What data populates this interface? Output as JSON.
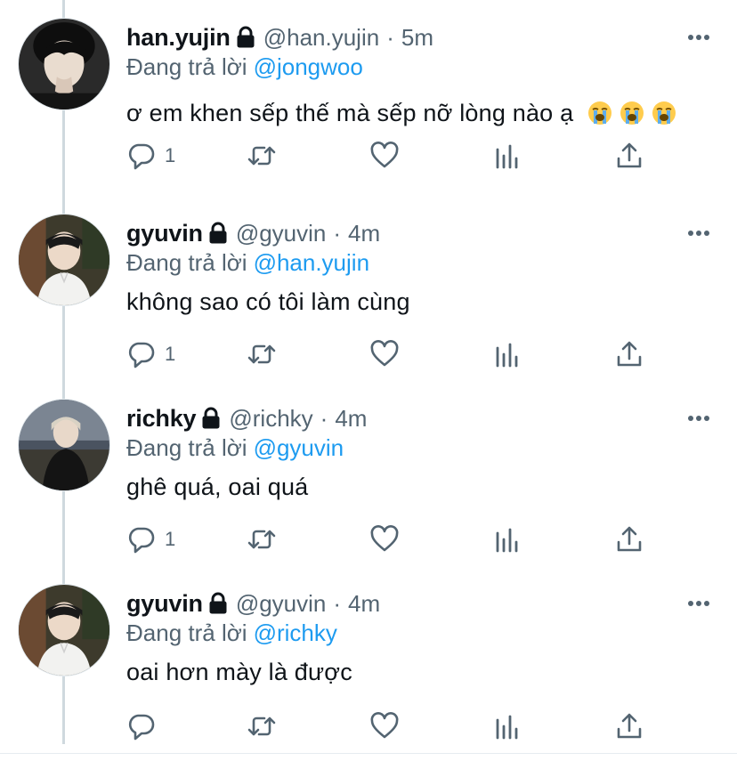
{
  "thread": {
    "reply_prefix": "Đang trả lời",
    "tweets": [
      {
        "name": "han.yujin",
        "handle": "@han.yujin",
        "separator": "·",
        "time": "5m",
        "reply_to": "@jongwoo",
        "text": "ơ em khen sếp thế mà sếp nỡ lòng nào ạ",
        "emojis": [
          "loudly-crying-face",
          "loudly-crying-face",
          "loudly-crying-face"
        ],
        "reply_count": "1"
      },
      {
        "name": "gyuvin",
        "handle": "@gyuvin",
        "separator": "·",
        "time": "4m",
        "reply_to": "@han.yujin",
        "text": "không sao có tôi làm cùng",
        "reply_count": "1"
      },
      {
        "name": "richky",
        "handle": "@richky",
        "separator": "·",
        "time": "4m",
        "reply_to": "@gyuvin",
        "text": "ghê quá, oai quá",
        "reply_count": "1"
      },
      {
        "name": "gyuvin",
        "handle": "@gyuvin",
        "separator": "·",
        "time": "4m",
        "reply_to": "@richky",
        "text": "oai hơn mày là được",
        "reply_count": ""
      }
    ]
  },
  "icons": {
    "lock": "lock-icon",
    "more": "more-options-icon",
    "reply": "reply-icon",
    "retweet": "retweet-icon",
    "like": "heart-icon",
    "views": "analytics-icon",
    "share": "share-icon"
  },
  "colors": {
    "text": "#0f1419",
    "secondary": "#536471",
    "mention": "#1d9bf0",
    "thread_line": "#cfd9de"
  }
}
